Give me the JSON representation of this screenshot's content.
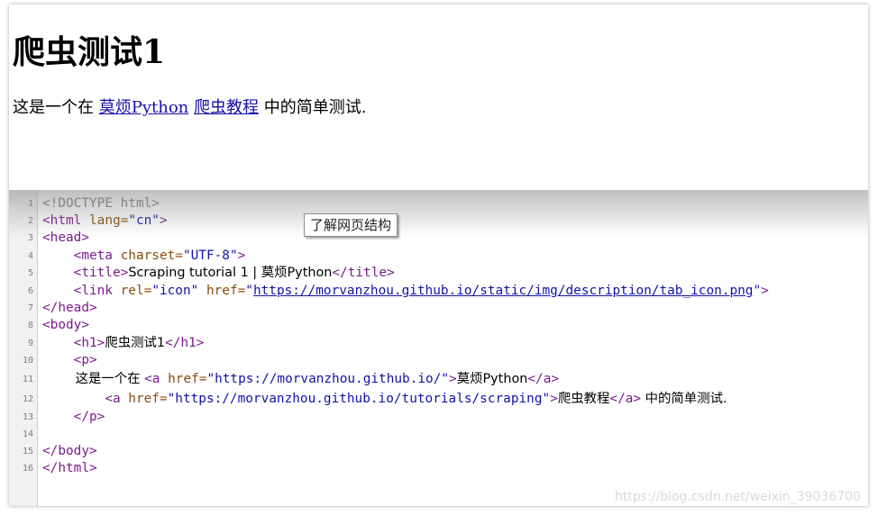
{
  "page": {
    "heading": "爬虫测试1",
    "para_text_before": "这是一个在 ",
    "link1_text": "莫烦Python",
    "para_space": " ",
    "link2_text": "爬虫教程",
    "para_text_after": " 中的简单测试."
  },
  "tooltip": "了解网页结构",
  "code": {
    "line_numbers": [
      "1",
      "2",
      "3",
      "4",
      "5",
      "6",
      "7",
      "8",
      "9",
      "10",
      "11",
      "12",
      "13",
      "14",
      "15",
      "16"
    ],
    "l1": "<!DOCTYPE html>",
    "l2_open": "<html",
    "l2_attr": " lang=",
    "l2_val": "\"cn\"",
    "l2_close": ">",
    "l3": "<head>",
    "l4_open": "    <meta",
    "l4_attr": " charset=",
    "l4_val": "\"UTF-8\"",
    "l4_close": ">",
    "l5_open": "    <title>",
    "l5_text": "Scraping tutorial 1 | 莫烦Python",
    "l5_close": "</title>",
    "l6_open": "    <link",
    "l6_attr1": " rel=",
    "l6_val1": "\"icon\"",
    "l6_attr2": " href=",
    "l6_q1": "\"",
    "l6_url": "https://morvanzhou.github.io/static/img/description/tab_icon.png",
    "l6_q2": "\"",
    "l6_close": ">",
    "l7": "</head>",
    "l8": "<body>",
    "l9_open": "    <h1>",
    "l9_text": "爬虫测试1",
    "l9_close": "</h1>",
    "l10": "    <p>",
    "l11_text": "        这是一个在 ",
    "l11_open": "<a",
    "l11_attr": " href=",
    "l11_val": "\"https://morvanzhou.github.io/\"",
    "l11_gt": ">",
    "l11_link": "莫烦Python",
    "l11_close": "</a>",
    "l12_indent": "        ",
    "l12_open": "<a",
    "l12_attr": " href=",
    "l12_val": "\"https://morvanzhou.github.io/tutorials/scraping\"",
    "l12_gt": ">",
    "l12_link": "爬虫教程",
    "l12_close": "</a>",
    "l12_text": " 中的简单测试.",
    "l13": "    </p>",
    "l14": "",
    "l15": "</body>",
    "l16": "</html>"
  },
  "watermark": "https://blog.csdn.net/weixin_39036700",
  "colors": {
    "tag": "#7a1a8e",
    "attribute": "#8a4b0c",
    "value": "#1212a8",
    "link": "#1a0dab"
  }
}
